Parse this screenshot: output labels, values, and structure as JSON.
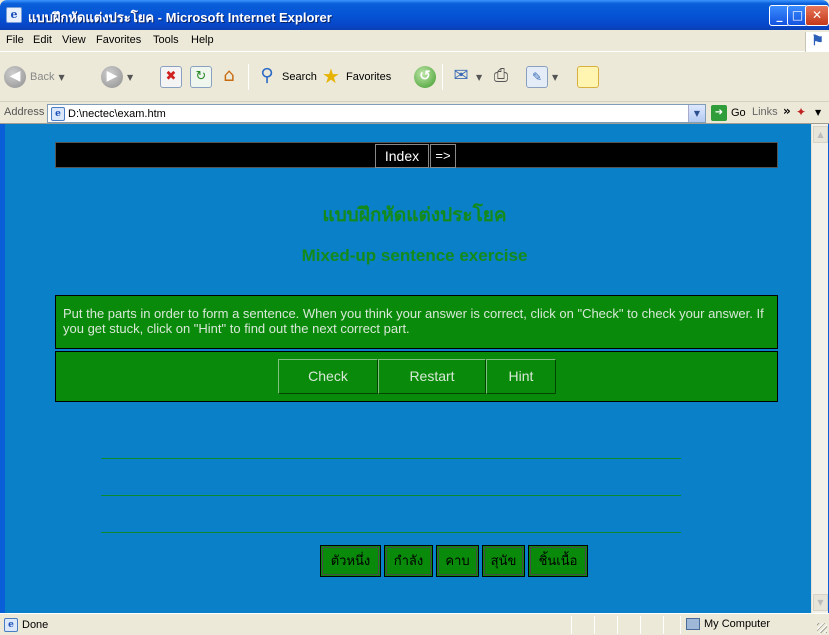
{
  "window": {
    "title": "แบบฝึกหัดแต่งประโยค - Microsoft Internet Explorer"
  },
  "menu": [
    "File",
    "Edit",
    "View",
    "Favorites",
    "Tools",
    "Help"
  ],
  "toolbar": {
    "back": "Back",
    "search": "Search",
    "favorites": "Favorites"
  },
  "address": {
    "label": "Address",
    "value": "D:\\nectec\\exam.htm",
    "go": "Go",
    "links": "Links"
  },
  "page": {
    "nav": {
      "index": "Index",
      "next": "=>"
    },
    "heading_thai": "แบบฝึกหัดแต่งประโยค",
    "heading_en": "Mixed-up sentence exercise",
    "instructions": "Put the parts in order to form a sentence. When you think your answer is correct, click on \"Check\" to check your answer. If you get stuck, click on \"Hint\" to find out the next correct part.",
    "buttons": {
      "check": "Check",
      "restart": "Restart",
      "hint": "Hint"
    },
    "words": [
      "ตัวหนึ่ง",
      "กำลัง",
      "คาบ",
      "สุนัข",
      "ชิ้นเนื้อ"
    ]
  },
  "status": {
    "text": "Done",
    "zone": "My Computer"
  },
  "colors": {
    "page_background": "#0a80c8",
    "panel_green": "#0a8a0a",
    "heading_green": "#138a1a"
  }
}
